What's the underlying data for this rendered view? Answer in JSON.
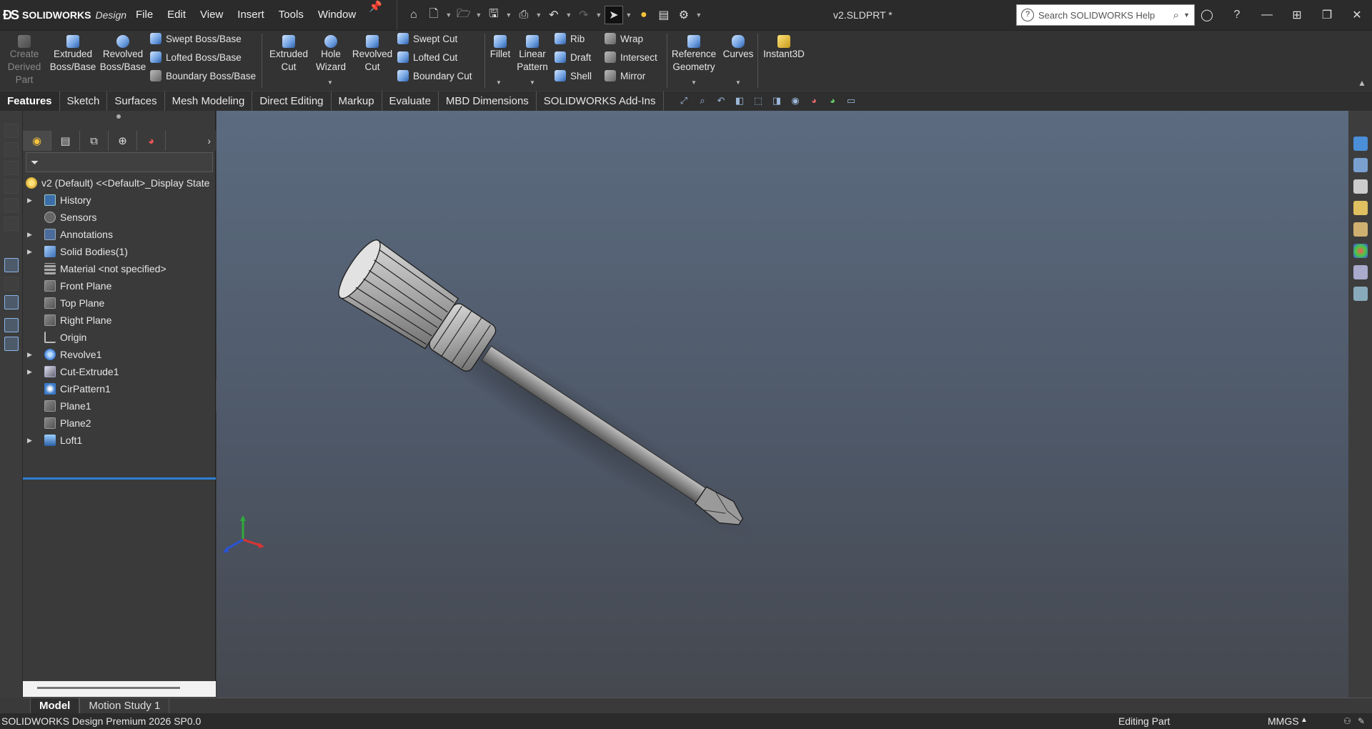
{
  "app": {
    "logo_text": "SOLIDWORKS",
    "logo_suffix": "Design",
    "document_title": "v2.SLDPRT *"
  },
  "menus": [
    "File",
    "Edit",
    "View",
    "Insert",
    "Tools",
    "Window"
  ],
  "search": {
    "placeholder": "Search SOLIDWORKS Help"
  },
  "ribbon": {
    "create_derived": "Create Derived Part",
    "extruded_boss": "Extruded Boss/Base",
    "revolved_boss": "Revolved Boss/Base",
    "swept_boss": "Swept Boss/Base",
    "lofted_boss": "Lofted Boss/Base",
    "boundary_boss": "Boundary Boss/Base",
    "extruded_cut": "Extruded Cut",
    "hole_wizard": "Hole Wizard",
    "revolved_cut": "Revolved Cut",
    "swept_cut": "Swept Cut",
    "lofted_cut": "Lofted Cut",
    "boundary_cut": "Boundary Cut",
    "fillet": "Fillet",
    "linear_pattern": "Linear Pattern",
    "rib": "Rib",
    "draft": "Draft",
    "shell": "Shell",
    "wrap": "Wrap",
    "intersect": "Intersect",
    "mirror": "Mirror",
    "reference_geometry": "Reference Geometry",
    "curves": "Curves",
    "instant3d": "Instant3D"
  },
  "tabs": [
    "Features",
    "Sketch",
    "Surfaces",
    "Mesh Modeling",
    "Direct Editing",
    "Markup",
    "Evaluate",
    "MBD Dimensions",
    "SOLIDWORKS Add-Ins"
  ],
  "tree": {
    "root": "v2 (Default) <<Default>_Display State",
    "items": [
      {
        "label": "History",
        "expandable": true
      },
      {
        "label": "Sensors",
        "expandable": false
      },
      {
        "label": "Annotations",
        "expandable": true
      },
      {
        "label": "Solid Bodies(1)",
        "expandable": true
      },
      {
        "label": "Material <not specified>",
        "expandable": false
      },
      {
        "label": "Front Plane",
        "expandable": false
      },
      {
        "label": "Top Plane",
        "expandable": false
      },
      {
        "label": "Right Plane",
        "expandable": false
      },
      {
        "label": "Origin",
        "expandable": false
      },
      {
        "label": "Revolve1",
        "expandable": true
      },
      {
        "label": "Cut-Extrude1",
        "expandable": true
      },
      {
        "label": "CirPattern1",
        "expandable": false
      },
      {
        "label": "Plane1",
        "expandable": false
      },
      {
        "label": "Plane2",
        "expandable": false
      },
      {
        "label": "Loft1",
        "expandable": true
      }
    ]
  },
  "bottom_tabs": [
    "Model",
    "Motion Study 1"
  ],
  "status": {
    "version": "SOLIDWORKS Design Premium 2026 SP0.0",
    "mode": "Editing Part",
    "units": "MMGS"
  },
  "colors": {
    "accent": "#2d7fd4",
    "viewport_top": "#5c6b80",
    "viewport_bottom": "#45484f"
  }
}
